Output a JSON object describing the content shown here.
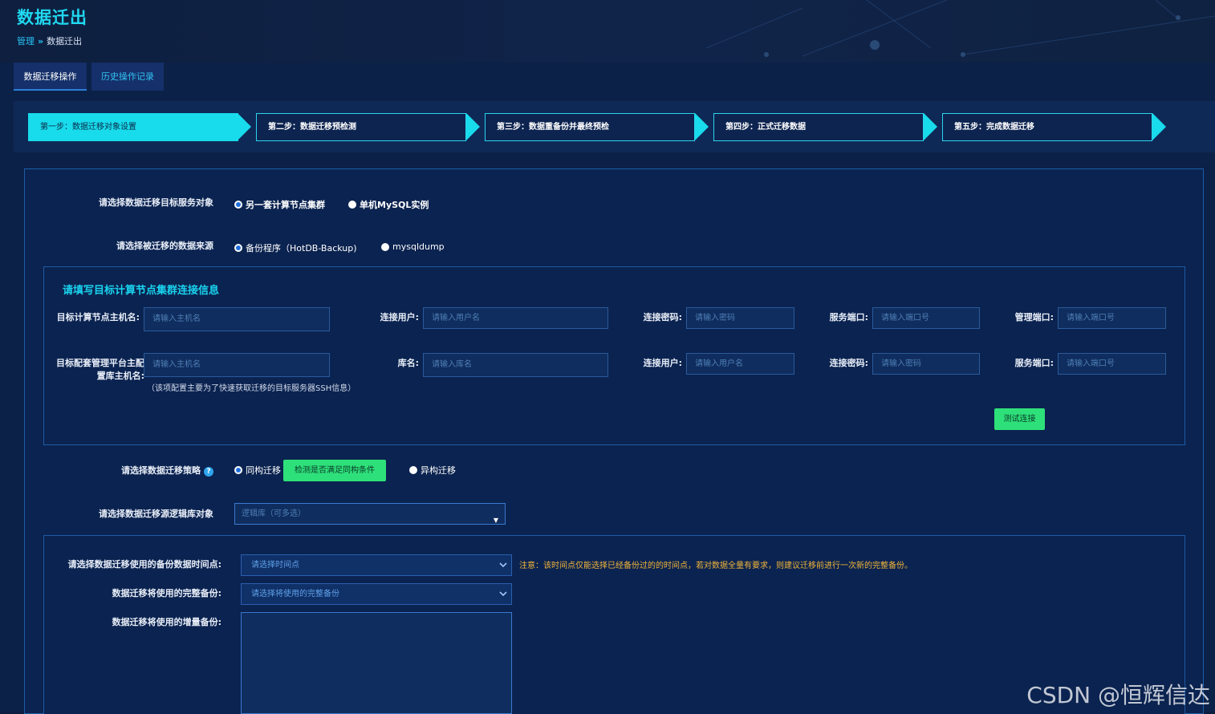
{
  "page": {
    "title": "数据迁出"
  },
  "breadcrumb": {
    "parent": "管理",
    "separator": "»",
    "current": "数据迁出"
  },
  "tabs": [
    {
      "label": "数据迁移操作",
      "active": true
    },
    {
      "label": "历史操作记录",
      "active": false
    }
  ],
  "steps": [
    {
      "label": "第一步：数据迁移对象设置",
      "active": true
    },
    {
      "label": "第二步：数据迁移预检测",
      "active": false
    },
    {
      "label": "第三步：数据重备份并最终预检",
      "active": false
    },
    {
      "label": "第四步：正式迁移数据",
      "active": false
    },
    {
      "label": "第五步：完成数据迁移",
      "active": false
    }
  ],
  "target_service": {
    "label": "请选择数据迁移目标服务对象",
    "options": [
      "另一套计算节点集群",
      "单机MySQL实例"
    ],
    "selected": "另一套计算节点集群"
  },
  "data_source": {
    "label": "请选择被迁移的数据来源",
    "options": [
      "备份程序（HotDB-Backup)",
      "mysqldump"
    ],
    "selected": "备份程序（HotDB-Backup)"
  },
  "connection": {
    "title": "请填写目标计算节点集群连接信息",
    "row1": {
      "host_label": "目标计算节点主机名:",
      "host_placeholder": "请输入主机名",
      "user_label": "连接用户:",
      "user_placeholder": "请输入用户名",
      "pwd_label": "连接密码:",
      "pwd_placeholder": "请输入密码",
      "svc_port_label": "服务端口:",
      "svc_port_placeholder": "请输入端口号",
      "mgmt_port_label": "管理端口:",
      "mgmt_port_placeholder": "请输入端口号"
    },
    "row2": {
      "host_label_line1": "目标配套管理平台主配",
      "host_label_line2": "置库主机名:",
      "host_placeholder": "请输入主机名",
      "db_label": "库名:",
      "db_placeholder": "请输入库名",
      "user_label": "连接用户:",
      "user_placeholder": "请输入用户名",
      "pwd_label": "连接密码:",
      "pwd_placeholder": "请输入密码",
      "svc_port_label": "服务端口:",
      "svc_port_placeholder": "请输入端口号"
    },
    "note": "（该项配置主要为了快速获取迁移的目标服务器SSH信息）",
    "test_button": "测试连接"
  },
  "strategy": {
    "label": "请选择数据迁移策略",
    "help": "?",
    "options": [
      "同构迁移",
      "异构迁移"
    ],
    "selected": "同构迁移",
    "check_button": "检测是否满足同构条件"
  },
  "logic_db": {
    "label": "请选择数据迁移源逻辑库对象",
    "placeholder": "逻辑库（可多选）",
    "caret": "▼"
  },
  "backup": {
    "time_label": "请选择数据迁移使用的备份数据时间点:",
    "time_placeholder": "请选择时间点",
    "full_label": "数据迁移将使用的完整备份:",
    "full_placeholder": "请选择将使用的完整备份",
    "incr_label": "数据迁移将使用的增量备份:",
    "warning": "注意：该时间点仅能选择已经备份过的的时间点，若对数据全量有要求，则建议迁移前进行一次新的完整备份。"
  },
  "watermark": "CSDN @恒辉信达",
  "colors": {
    "accent": "#18dbeb",
    "green": "#2ee07a",
    "warn": "#f2b63a",
    "bg": "#0b1c3d"
  }
}
